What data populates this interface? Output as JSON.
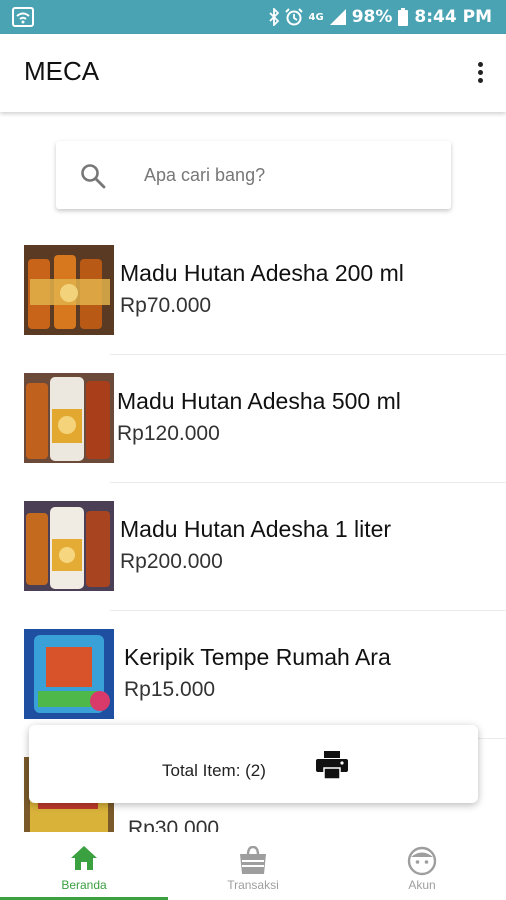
{
  "status_bar": {
    "network": "4G",
    "battery": "98%",
    "time": "8:44 PM"
  },
  "app_bar": {
    "title": "MECA",
    "menu_icon": "more-vertical-icon"
  },
  "search": {
    "placeholder": "Apa cari bang?",
    "icon": "search-icon"
  },
  "products": [
    {
      "name": "Madu Hutan Adesha 200 ml",
      "price": "Rp70.000"
    },
    {
      "name": "Madu Hutan Adesha 500 ml",
      "price": "Rp120.000"
    },
    {
      "name": "Madu Hutan Adesha 1 liter",
      "price": "Rp200.000"
    },
    {
      "name": "Keripik Tempe Rumah Ara",
      "price": "Rp15.000"
    },
    {
      "name": "",
      "price": "Rp30.000"
    }
  ],
  "cart": {
    "total_label": "Total Item: (2)",
    "print_icon": "printer-icon"
  },
  "bottom_nav": {
    "tabs": [
      {
        "label": "Beranda",
        "icon": "home-icon",
        "active": true
      },
      {
        "label": "Transaksi",
        "icon": "shopping-bag-icon",
        "active": false
      },
      {
        "label": "Akun",
        "icon": "face-icon",
        "active": false
      }
    ]
  },
  "colors": {
    "status_bar": "#4aa3b3",
    "accent_green": "#3aa040",
    "inactive_gray": "#9e9e9e"
  }
}
